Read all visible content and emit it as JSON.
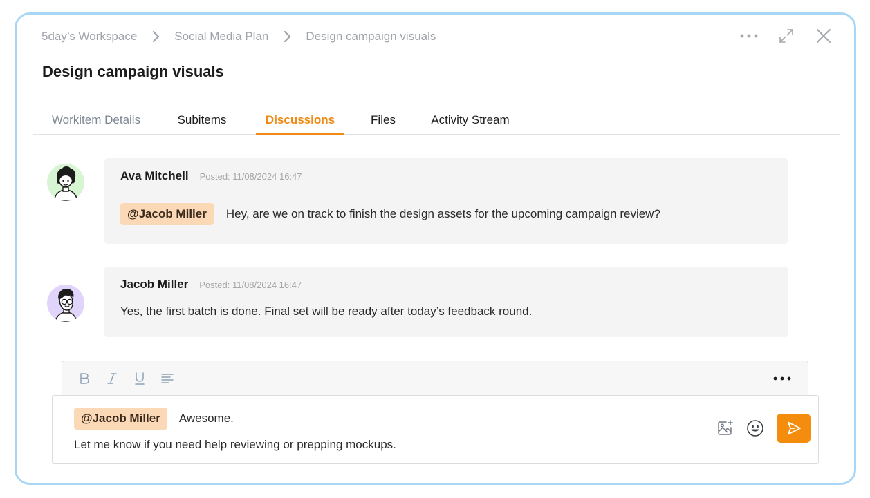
{
  "breadcrumb": {
    "items": [
      "5day’s Workspace",
      "Social Media Plan",
      "Design campaign visuals"
    ]
  },
  "header": {
    "title": "Design campaign visuals",
    "more_icon": "more-horizontal-icon",
    "expand_icon": "expand-icon",
    "close_icon": "close-icon"
  },
  "tabs": [
    {
      "label": "Workitem Details",
      "state": "muted"
    },
    {
      "label": "Subitems",
      "state": "normal"
    },
    {
      "label": "Discussions",
      "state": "active"
    },
    {
      "label": "Files",
      "state": "normal"
    },
    {
      "label": "Activity Stream",
      "state": "normal"
    }
  ],
  "comments": [
    {
      "author": "Ava Mitchell",
      "posted": "Posted: 11/08/2024 16:47",
      "mention": "@Jacob Miller",
      "text": "Hey, are we on track to finish the design assets for the upcoming campaign review?",
      "avatar_bg": "#d7f5d2"
    },
    {
      "author": "Jacob Miller",
      "posted": "Posted: 11/08/2024 16:47",
      "text": "Yes, the first batch is done. Final set will be ready after today’s feedback round.",
      "avatar_bg": "#e1d4fb"
    }
  ],
  "editor": {
    "toolbar": [
      "bold-icon",
      "italic-icon",
      "underline-icon",
      "align-icon",
      "more-horizontal-icon"
    ],
    "mention": "@Jacob Miller",
    "line1": "Awesome.",
    "line2": "Let me know if you need help reviewing or prepping mockups.",
    "actions": [
      "add-image-icon",
      "emoji-icon",
      "send-icon"
    ]
  },
  "colors": {
    "accent": "#f48c0d",
    "active_tab": "#f08a12",
    "border": "#a9d6f5",
    "mention_bg": "#fbd9b6"
  }
}
